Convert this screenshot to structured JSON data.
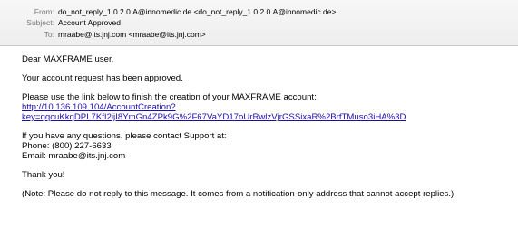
{
  "header": {
    "from_label": "From:",
    "from_value": "do_not_reply_1.0.2.0.A@innomedic.de <do_not_reply_1.0.2.0.A@innomedic.de>",
    "subject_label": "Subject:",
    "subject_value": "Account Approved",
    "to_label": "To:",
    "to_value": "mraabe@its.jnj.com <mraabe@its.jnj.com>"
  },
  "body": {
    "greeting": "Dear MAXFRAME user,",
    "approved": "Your account request has been approved.",
    "instruction": "Please use the link below to finish the creation of your MAXFRAME account:",
    "link_line1": "http://10.136.109.104/AccountCreation?",
    "link_line2": "key=qqcuKkqDPL7KfI2ijI8YmGn4ZPk9G%2F67VaYD17oUrRwlzVjrGSSixaR%2BrfTMuso3iHA%3D",
    "questions": "If you have any questions, please contact Support at:",
    "phone": "Phone: (800) 227-6633",
    "email": "Email: mraabe@its.jnj.com",
    "thanks": "Thank you!",
    "note": "(Note: Please do not reply to this message. It comes from a notification-only address that cannot accept replies.)"
  },
  "colors": {
    "link": "#1a0dab",
    "header_label": "#7a7a7a",
    "header_bg": "#f0f0f0"
  }
}
